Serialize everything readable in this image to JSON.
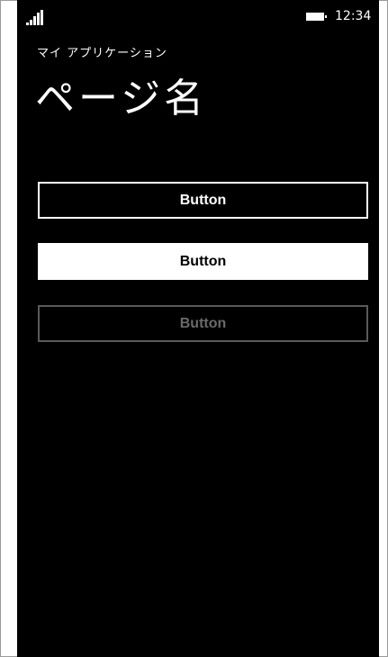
{
  "status_bar": {
    "signal_icon": "signal-strength-icon",
    "battery_icon": "battery-icon",
    "time": "12:34"
  },
  "header": {
    "app_title": "マイ アプリケーション",
    "page_title": "ページ名"
  },
  "buttons": [
    {
      "label": "Button",
      "state": "normal"
    },
    {
      "label": "Button",
      "state": "pressed"
    },
    {
      "label": "Button",
      "state": "disabled"
    }
  ],
  "colors": {
    "background": "#000000",
    "foreground": "#ffffff",
    "disabled": "#6a6a6a"
  }
}
